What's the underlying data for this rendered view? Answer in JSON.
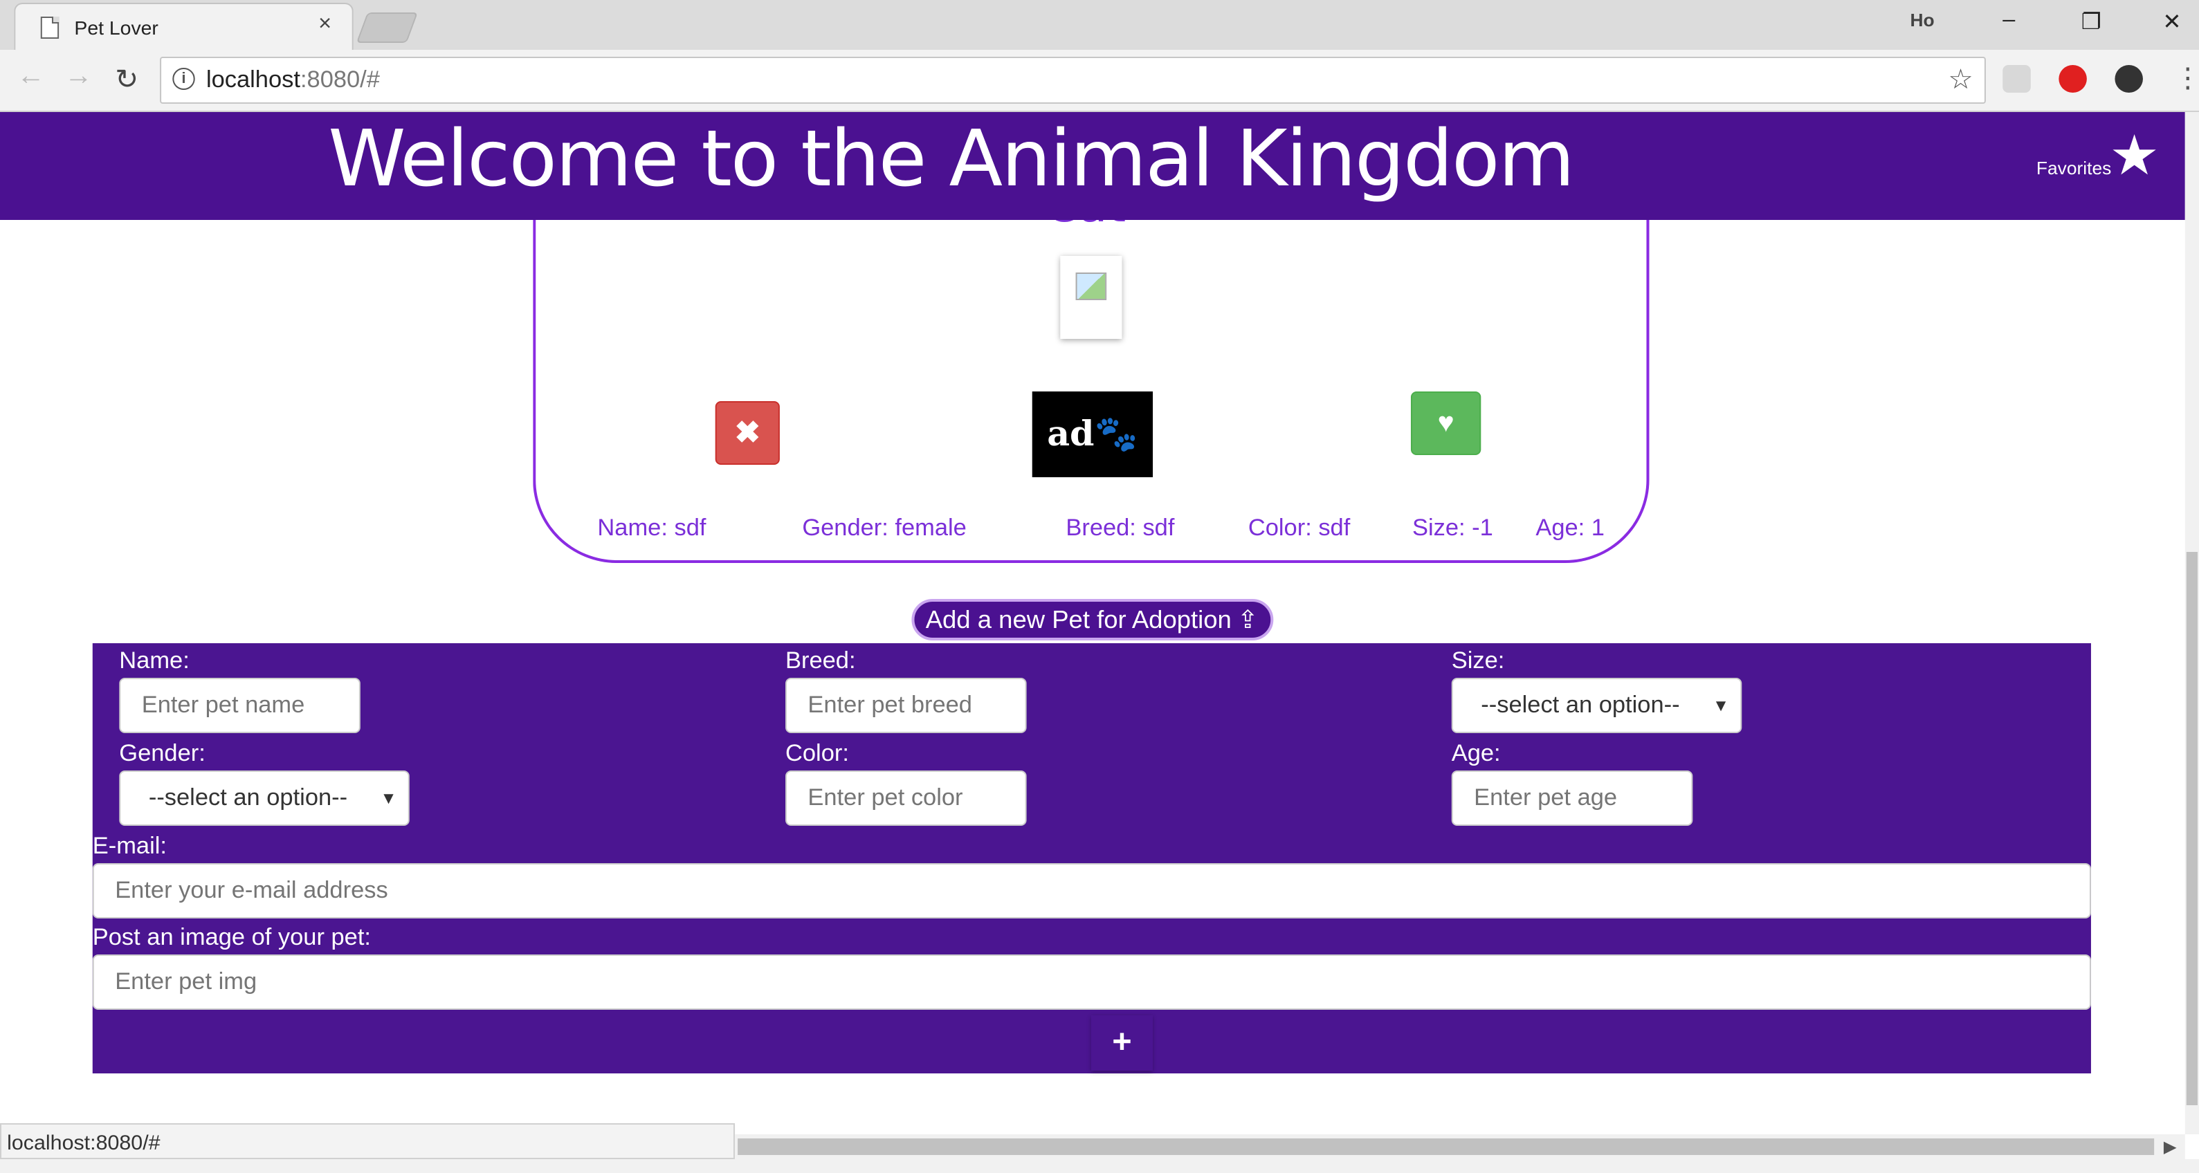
{
  "browser": {
    "tab_title": "Pet Lover",
    "tab_close": "×",
    "profile": "Ho",
    "window_controls": {
      "minimize": "–",
      "restore": "❐",
      "close": "✕"
    },
    "url_host": "localhost",
    "url_rest": ":8080/#",
    "status_url": "localhost:8080/#"
  },
  "header": {
    "title": "Welcome to the Animal Kingdom",
    "favorites_label": "Favorites"
  },
  "card": {
    "heading": "Cat",
    "logo_text": "ad🐾pt",
    "reject_icon": "✖",
    "like_icon": "♥",
    "info": {
      "name": "Name: sdf",
      "gender": "Gender: female",
      "breed": "Breed: sdf",
      "color": "Color: sdf",
      "size": "Size: -1",
      "age": "Age: 1"
    }
  },
  "add_pet_button": {
    "label": "Add a new Pet for Adoption",
    "icon": "upload-icon"
  },
  "form": {
    "name": {
      "label": "Name:",
      "placeholder": "Enter pet name"
    },
    "breed": {
      "label": "Breed:",
      "placeholder": "Enter pet breed"
    },
    "size": {
      "label": "Size:",
      "selected": "--select an option--"
    },
    "gender": {
      "label": "Gender:",
      "selected": "--select an option--"
    },
    "color": {
      "label": "Color:",
      "placeholder": "Enter pet color"
    },
    "age": {
      "label": "Age:",
      "placeholder": "Enter pet age"
    },
    "email": {
      "label": "E-mail:",
      "placeholder": "Enter your e-mail address"
    },
    "image": {
      "label": "Post an image of your pet:",
      "placeholder": "Enter pet img"
    },
    "submit_icon": "+"
  },
  "colors": {
    "header_bg": "#4b1191",
    "form_bg": "#4b1591",
    "card_border": "#8a2be2",
    "card_text": "#7b2fd8",
    "reject_btn": "#d9534f",
    "like_btn": "#5cb85c"
  }
}
